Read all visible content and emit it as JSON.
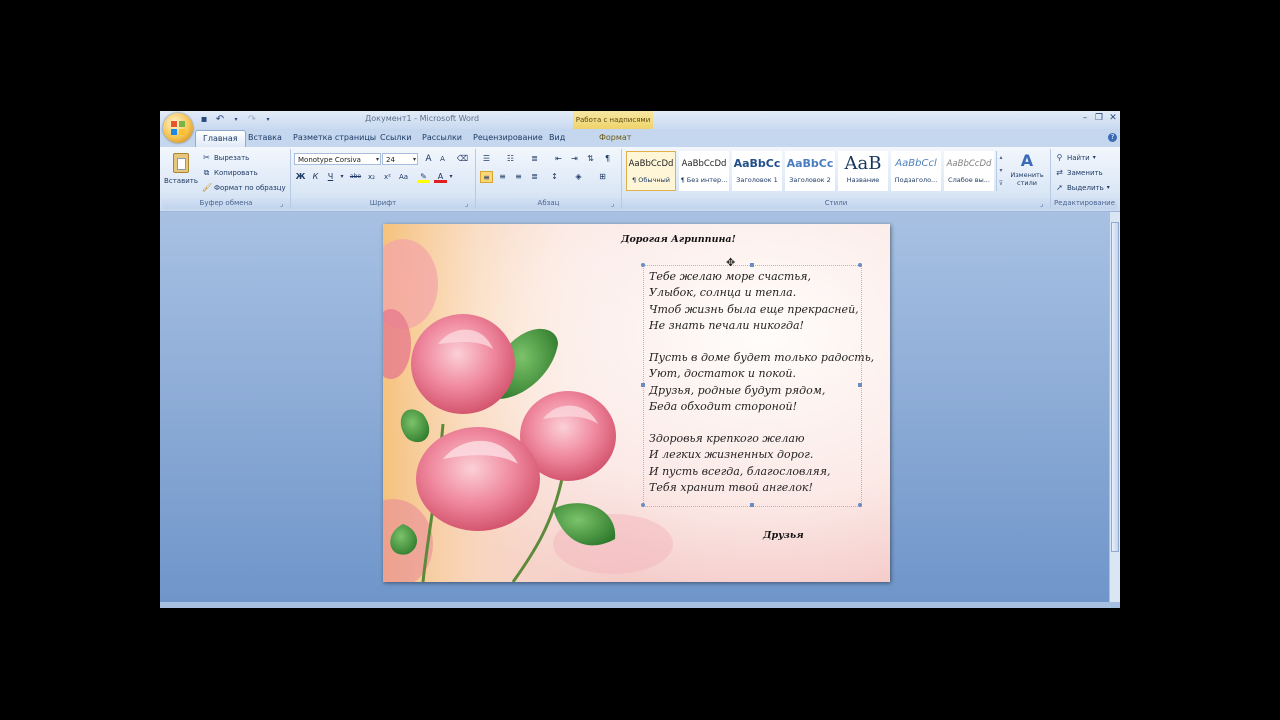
{
  "window": {
    "title": "Документ1 - Microsoft Word",
    "context_tab_title": "Работа с надписями"
  },
  "tabs": [
    {
      "label": "Главная",
      "active": true
    },
    {
      "label": "Вставка"
    },
    {
      "label": "Разметка страницы"
    },
    {
      "label": "Ссылки"
    },
    {
      "label": "Рассылки"
    },
    {
      "label": "Рецензирование"
    },
    {
      "label": "Вид"
    },
    {
      "label": "Формат",
      "context": true
    }
  ],
  "clipboard": {
    "paste_label": "Вставить",
    "cut_label": "Вырезать",
    "copy_label": "Копировать",
    "format_painter_label": "Формат по образцу",
    "group_label": "Буфер обмена"
  },
  "font": {
    "font_name": "Monotype Corsiva",
    "font_size": "24",
    "bold": "Ж",
    "italic": "К",
    "underline": "Ч",
    "strike": "abe",
    "subscript": "x₂",
    "superscript": "x²",
    "change_case": "Aa",
    "font_color_letter": "A",
    "grow": "A",
    "shrink": "A",
    "group_label": "Шрифт"
  },
  "paragraph": {
    "group_label": "Абзац"
  },
  "styles": {
    "group_label": "Стили",
    "items": [
      {
        "sample": "AaBbCcDd",
        "name": "¶ Обычный",
        "selected": true
      },
      {
        "sample": "AaBbCcDd",
        "name": "¶ Без интер..."
      },
      {
        "sample": "AaBbCc",
        "name": "Заголовок 1"
      },
      {
        "sample": "AaBbCc",
        "name": "Заголовок 2"
      },
      {
        "sample": "AaB",
        "name": "Название"
      },
      {
        "sample": "AaBbCcl",
        "name": "Подзаголо..."
      },
      {
        "sample": "AaBbCcDd",
        "name": "Слабое вы..."
      }
    ],
    "change_styles_label": "Изменить стили"
  },
  "editing": {
    "find_label": "Найти",
    "replace_label": "Заменить",
    "select_label": "Выделить",
    "group_label": "Редактирование"
  },
  "document": {
    "greeting": "Дорогая Агриппина!",
    "stanzas": [
      "Тебе желаю море счастья,\nУлыбок, солнца и тепла.\nЧтоб жизнь была еще прекрасней,\nНе знать печали никогда!",
      "Пусть в доме будет только радость,\nУют, достаток и покой.\nДрузья, родные будут рядом,\nБеда обходит стороной!",
      "Здоровья крепкого желаю\nИ легких жизненных дорог.\nИ пусть всегда, благословляя,\nТебя хранит твой ангелок!"
    ],
    "signature": "Друзья"
  },
  "colors": {
    "ribbon_bg": "#dbe7f6",
    "workspace_bg": "#6f95c9",
    "rose": "#f08aa0",
    "leaf": "#3f9a3a",
    "highlight_yellow": "#ffff00",
    "font_color_red": "#e02020"
  }
}
